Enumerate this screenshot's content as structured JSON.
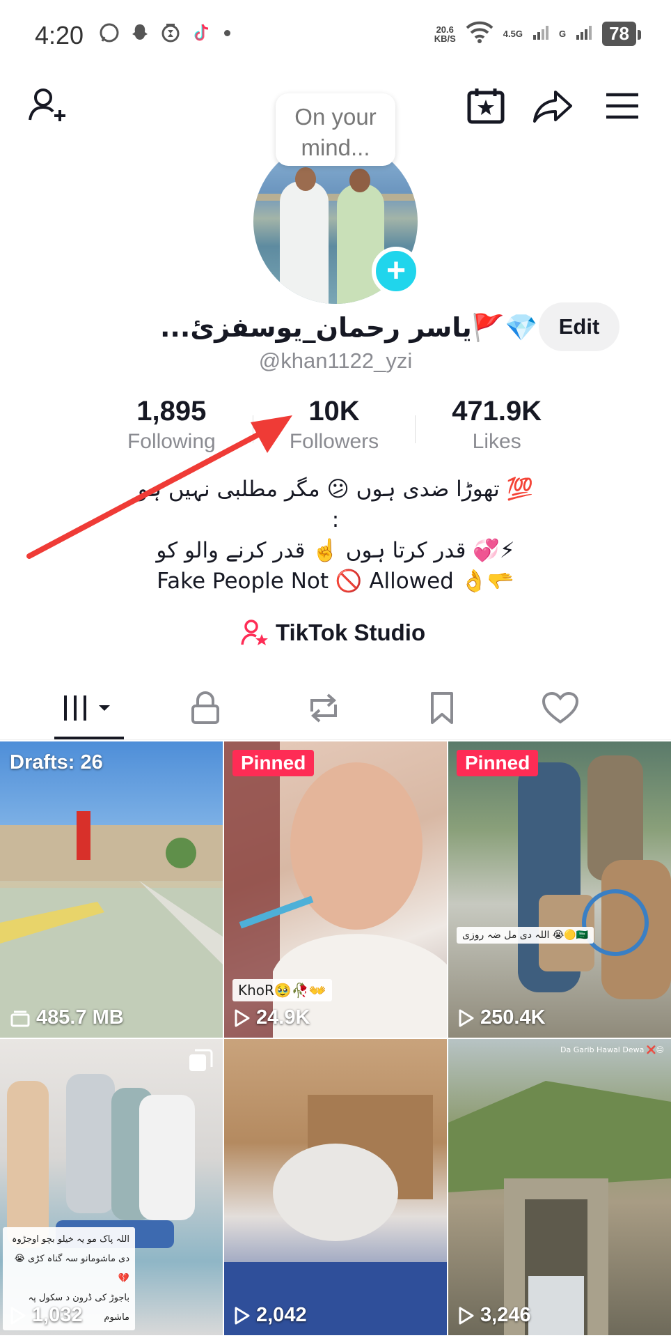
{
  "status_bar": {
    "time": "4:20",
    "speed_value": "20.6",
    "speed_unit": "KB/S",
    "net1": "4.5G",
    "net2": "G",
    "battery": "78",
    "left_icons": [
      "whatsapp-icon",
      "snapchat-icon",
      "hourglass-icon",
      "tiktok-icon"
    ],
    "right_icons": [
      "wifi-icon",
      "signal-icon",
      "battery-icon"
    ]
  },
  "top_bar": {
    "icons": [
      "add-friend-icon",
      "calendar-star-icon",
      "share-icon",
      "menu-icon"
    ]
  },
  "profile": {
    "mind_bubble": "On your mind...",
    "display_name": "...یاسر رحمان_یوسفزئ🚩💎",
    "handle": "@khan1122_yzi",
    "edit_label": "Edit"
  },
  "stats": [
    {
      "value": "1,895",
      "label": "Following"
    },
    {
      "value": "10K",
      "label": "Followers"
    },
    {
      "value": "471.9K",
      "label": "Likes"
    }
  ],
  "bio": {
    "line1": "💯 تھوڑا ضدی ہوں 😕 مگر مطلبی نہیں ہو",
    "line2": ":",
    "line3": "⚡💞 قدر کرتا ہوں ☝️ قدر کرنے والو کو",
    "line4": "Fake People Not 🚫 Allowed 👌🫳"
  },
  "studio": {
    "label": "TikTok Studio"
  },
  "tabs": [
    "videos-grid-icon",
    "private-lock-icon",
    "reposts-icon",
    "favorites-bookmark-icon",
    "liked-heart-icon"
  ],
  "grid": {
    "tiles": [
      {
        "label": "Drafts: 26",
        "bottom": "485.7 MB",
        "caption": ""
      },
      {
        "label": "Pinned",
        "bottom": "24.9K",
        "caption": "KhoR🥹🥀👐"
      },
      {
        "label": "Pinned",
        "bottom": "250.4K",
        "caption": "اللہ دی مل ضہ روزی 😭🟡🇸🇦"
      },
      {
        "label": "",
        "bottom": "1,032",
        "caption": "اللہ پاک مو یہ خیلو بچو اوجڑوہ\nدی ماشومانو سہ گناہ کڑی 😭💔\nباجوڑ کی ڈرون د سکول پہ ماشوم"
      },
      {
        "label": "",
        "bottom": "2,042",
        "caption": ""
      },
      {
        "label": "",
        "bottom": "3,246",
        "caption": "Da Garib Hawal Dewa ❌😐"
      }
    ]
  },
  "colors": {
    "accent": "#fe2c55",
    "plus_badge": "#20d5ec",
    "annotation_arrow": "#ef3b36"
  }
}
